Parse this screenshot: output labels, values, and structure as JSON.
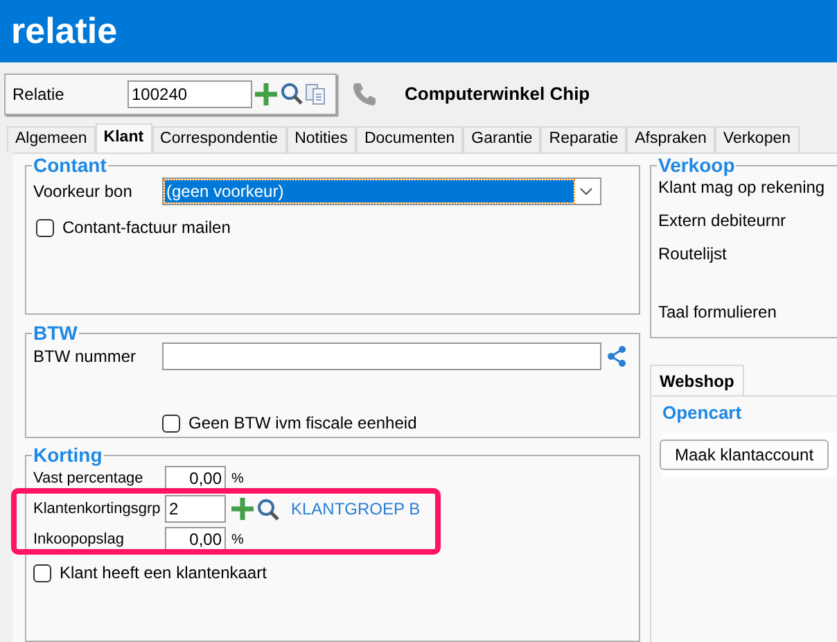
{
  "window": {
    "title": "relatie"
  },
  "toolbar": {
    "label": "Relatie",
    "value": "100240",
    "name": "Computerwinkel Chip"
  },
  "tabs": [
    {
      "label": "Algemeen",
      "selected": false
    },
    {
      "label": "Klant",
      "selected": true
    },
    {
      "label": "Correspondentie",
      "selected": false
    },
    {
      "label": "Notities",
      "selected": false
    },
    {
      "label": "Documenten",
      "selected": false
    },
    {
      "label": "Garantie",
      "selected": false
    },
    {
      "label": "Reparatie",
      "selected": false
    },
    {
      "label": "Afspraken",
      "selected": false
    },
    {
      "label": "Verkopen",
      "selected": false
    }
  ],
  "contant": {
    "title": "Contant",
    "voorkeur_label": "Voorkeur bon",
    "voorkeur_value": "(geen voorkeur)",
    "mail_label": "Contant-factuur mailen",
    "mail_checked": false
  },
  "btw": {
    "title": "BTW",
    "nummer_label": "BTW nummer",
    "fiscaal_label": "Geen BTW ivm fiscale eenheid",
    "fiscaal_checked": false
  },
  "korting": {
    "title": "Korting",
    "rows": [
      {
        "label": "Vast percentage",
        "value": "0,00",
        "unit": "%",
        "kind": "number"
      },
      {
        "label": "Klantenkortingsgrp",
        "value": "2",
        "group": "KLANTGROEP B",
        "kind": "lookup"
      },
      {
        "label": "Inkoopopslag",
        "value": "0,00",
        "unit": "%",
        "kind": "number"
      }
    ],
    "kaart_label": "Klant heeft een klantenkaart",
    "kaart_checked": false
  },
  "verkoop": {
    "title": "Verkoop",
    "labels": [
      "Klant mag op rekening",
      "Extern debiteurnr",
      "Routelijst",
      "Taal formulieren"
    ]
  },
  "webshop": {
    "tab": "Webshop",
    "title": "Opencart",
    "button": "Maak klantaccount"
  }
}
